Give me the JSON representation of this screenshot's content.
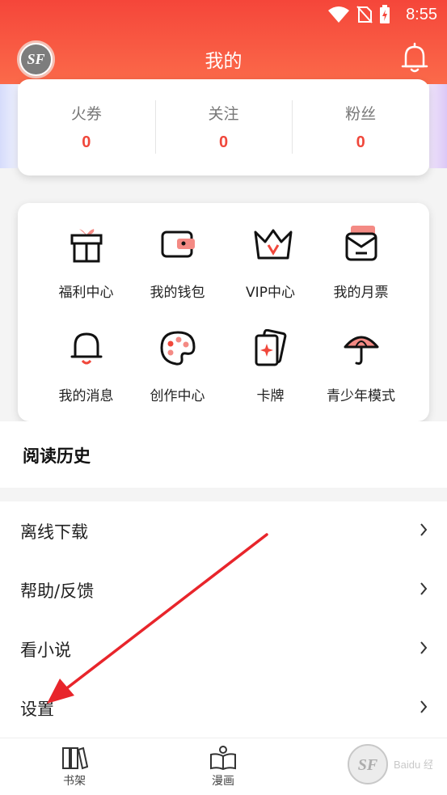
{
  "status_bar": {
    "time": "8:55"
  },
  "header": {
    "title": "我的",
    "avatar_text": "SF"
  },
  "stats": [
    {
      "label": "火券",
      "value": "0"
    },
    {
      "label": "关注",
      "value": "0"
    },
    {
      "label": "粉丝",
      "value": "0"
    }
  ],
  "grid": [
    {
      "label": "福利中心",
      "icon": "gift-icon"
    },
    {
      "label": "我的钱包",
      "icon": "wallet-icon"
    },
    {
      "label": "VIP中心",
      "icon": "crown-icon"
    },
    {
      "label": "我的月票",
      "icon": "ticket-icon"
    },
    {
      "label": "我的消息",
      "icon": "bell-icon"
    },
    {
      "label": "创作中心",
      "icon": "palette-icon"
    },
    {
      "label": "卡牌",
      "icon": "cards-icon"
    },
    {
      "label": "青少年模式",
      "icon": "umbrella-icon"
    }
  ],
  "history": {
    "title": "阅读历史"
  },
  "menu": [
    {
      "label": "离线下载"
    },
    {
      "label": "帮助/反馈"
    },
    {
      "label": "看小说"
    },
    {
      "label": "设置"
    }
  ],
  "bottom_nav": [
    {
      "label": "书架",
      "icon": "bookshelf-icon"
    },
    {
      "label": "漫画",
      "icon": "open-book-icon"
    }
  ],
  "watermark": {
    "text": "Baidu 经验"
  },
  "colors": {
    "accent": "#f5463a",
    "stat_value": "#f0473b"
  }
}
